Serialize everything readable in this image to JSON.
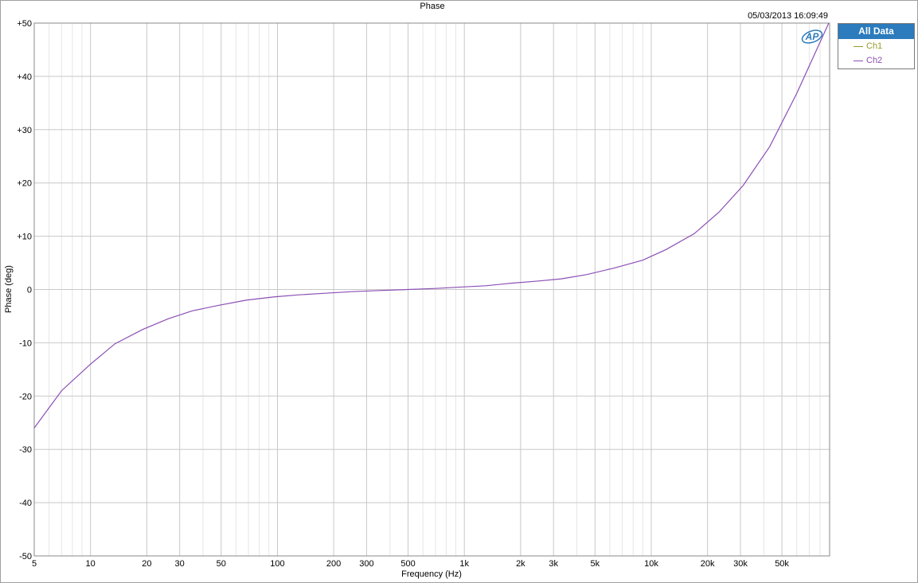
{
  "chart_data": {
    "type": "line",
    "title": "Phase",
    "timestamp": "05/03/2013 16:09:49",
    "xlabel": "Frequency (Hz)",
    "ylabel": "Phase (deg)",
    "xscale": "log",
    "xlim": [
      5,
      90000
    ],
    "ylim": [
      -50,
      50
    ],
    "grid": true,
    "legend_position": "right-top",
    "x_tick_values": [
      5,
      10,
      20,
      30,
      50,
      100,
      200,
      300,
      500,
      1000,
      2000,
      3000,
      5000,
      10000,
      20000,
      30000,
      50000
    ],
    "x_tick_labels": [
      "5",
      "10",
      "20",
      "30",
      "50",
      "100",
      "200",
      "300",
      "500",
      "1k",
      "2k",
      "3k",
      "5k",
      "10k",
      "20k",
      "30k",
      "50k"
    ],
    "y_tick_values": [
      50,
      40,
      30,
      20,
      10,
      0,
      -10,
      -20,
      -30,
      -40,
      -50
    ],
    "y_tick_labels": [
      "+50",
      "+40",
      "+30",
      "+20",
      "+10",
      "0",
      "-10",
      "-20",
      "-30",
      "-40",
      "-50"
    ],
    "series": [
      {
        "name": "Ch1",
        "color": "#9a9a2a",
        "visible": false,
        "x": [],
        "y": []
      },
      {
        "name": "Ch2",
        "color": "#8b4fb5",
        "x": [
          5,
          7,
          10,
          13.5,
          19,
          26,
          35,
          48,
          68,
          95,
          130,
          180,
          250,
          350,
          500,
          700,
          1000,
          1300,
          1800,
          2500,
          3300,
          4500,
          6300,
          9000,
          12000,
          17000,
          23000,
          31000,
          43000,
          60000,
          89000
        ],
        "y": [
          -26.0,
          -19.0,
          -14.0,
          -10.2,
          -7.5,
          -5.5,
          -4.0,
          -3.0,
          -2.0,
          -1.4,
          -1.0,
          -0.7,
          -0.4,
          -0.2,
          0.0,
          0.2,
          0.5,
          0.7,
          1.2,
          1.6,
          2.0,
          2.8,
          4.0,
          5.5,
          7.5,
          10.5,
          14.5,
          19.5,
          26.8,
          36.8,
          50.0
        ]
      }
    ]
  },
  "legend": {
    "header": "All Data",
    "items": [
      {
        "label": "Ch1",
        "color": "#9a9a2a"
      },
      {
        "label": "Ch2",
        "color": "#8b4fb5"
      }
    ]
  },
  "logo": {
    "text": "AP",
    "color": "#2b7bbd"
  }
}
